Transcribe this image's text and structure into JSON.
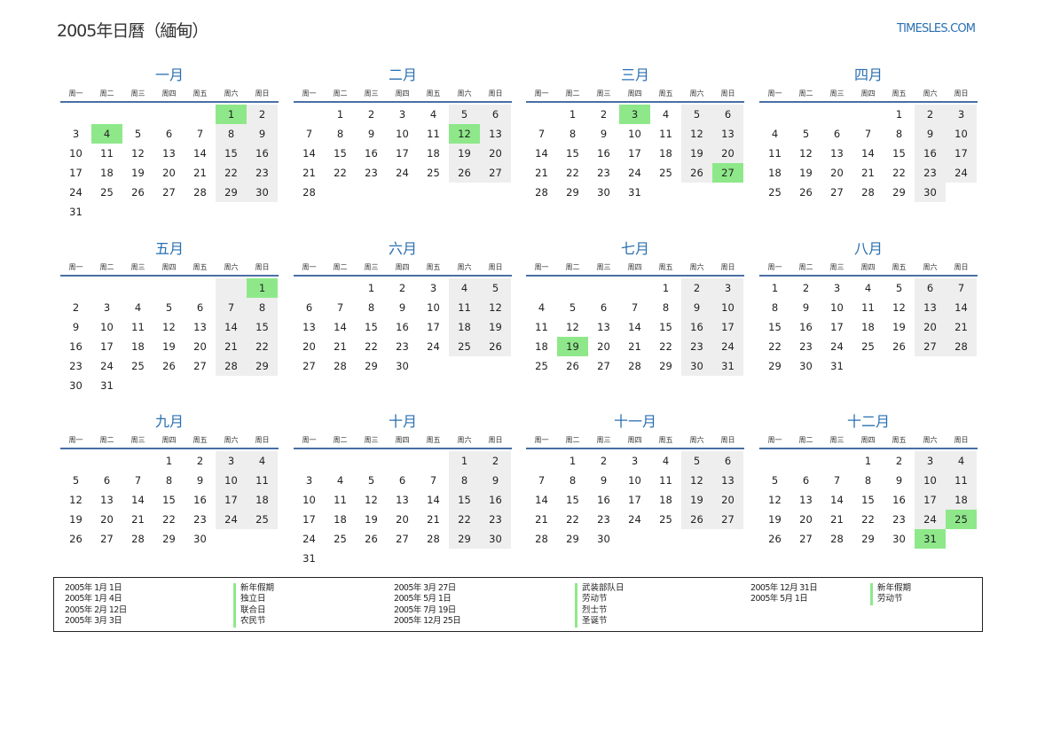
{
  "header": {
    "title": "2005年日曆（緬甸）",
    "site": "TIMESLES.COM"
  },
  "weekdays": [
    "周一",
    "周二",
    "周三",
    "周四",
    "周五",
    "周六",
    "周日"
  ],
  "months": [
    {
      "name": "一月",
      "start": 6,
      "days": 31,
      "highlights": [
        1,
        4
      ]
    },
    {
      "name": "二月",
      "start": 2,
      "days": 28,
      "highlights": [
        12
      ]
    },
    {
      "name": "三月",
      "start": 2,
      "days": 31,
      "highlights": [
        3,
        27
      ]
    },
    {
      "name": "四月",
      "start": 5,
      "days": 30,
      "highlights": []
    },
    {
      "name": "五月",
      "start": 7,
      "days": 31,
      "highlights": [
        1
      ]
    },
    {
      "name": "六月",
      "start": 3,
      "days": 30,
      "highlights": []
    },
    {
      "name": "七月",
      "start": 5,
      "days": 31,
      "highlights": [
        19
      ]
    },
    {
      "name": "八月",
      "start": 1,
      "days": 31,
      "highlights": []
    },
    {
      "name": "九月",
      "start": 4,
      "days": 30,
      "highlights": []
    },
    {
      "name": "十月",
      "start": 6,
      "days": 31,
      "highlights": []
    },
    {
      "name": "十一月",
      "start": 2,
      "days": 30,
      "highlights": []
    },
    {
      "name": "十二月",
      "start": 4,
      "days": 31,
      "highlights": [
        25,
        31
      ]
    }
  ],
  "holidays": {
    "col1": {
      "dates": [
        "2005年 1月 1日",
        "2005年 1月 4日",
        "2005年 2月 12日",
        "2005年 3月 3日"
      ],
      "names": [
        "新年假期",
        "独立日",
        "联合日",
        "农民节"
      ]
    },
    "col2": {
      "dates": [
        "2005年 3月 27日",
        "2005年 5月 1日",
        "2005年 7月 19日",
        "2005年 12月 25日"
      ],
      "names": [
        "武装部队日",
        "劳动节",
        "烈士节",
        "圣诞节"
      ]
    },
    "col3": {
      "dates": [
        "2005年 12月 31日",
        "2005年 5月 1日"
      ],
      "names": [
        "新年假期",
        "劳动节"
      ]
    }
  }
}
